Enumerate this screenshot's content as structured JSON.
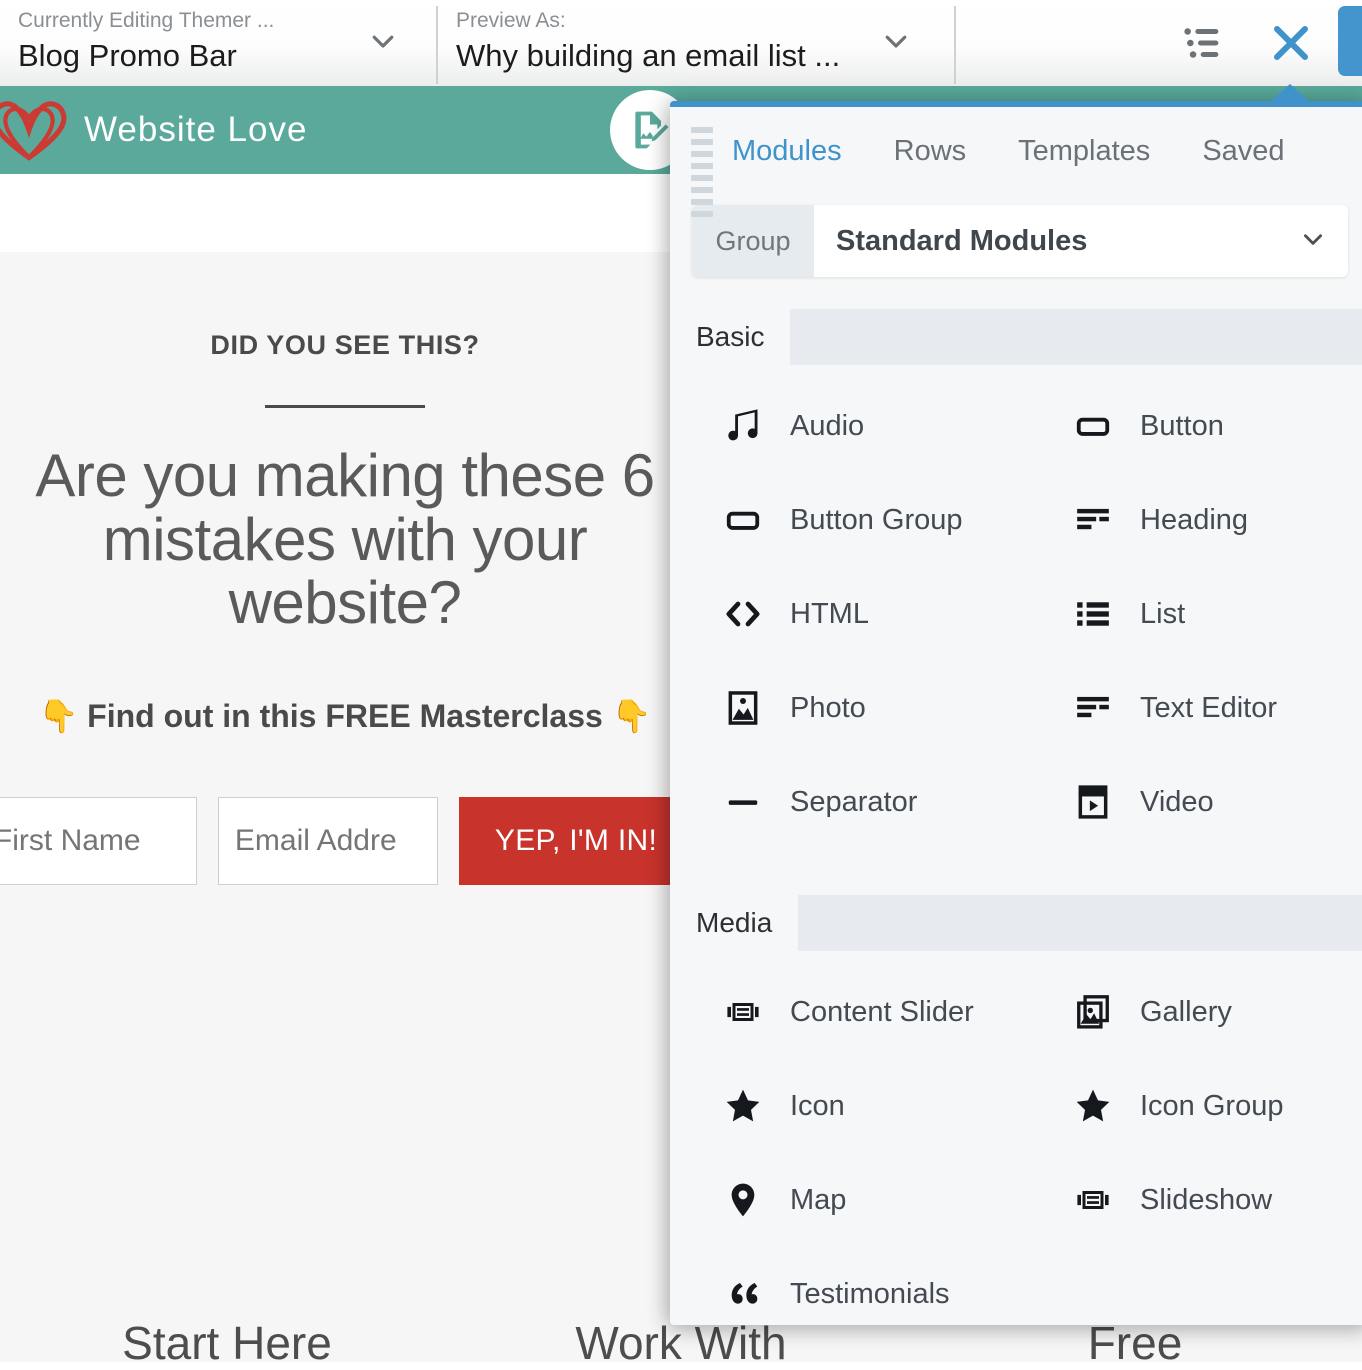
{
  "topbar": {
    "editing": {
      "label": "Currently Editing Themer ...",
      "value": "Blog Promo Bar",
      "caret_icon": "chevron-down-icon"
    },
    "preview": {
      "label": "Preview As:",
      "value": "Why building an email list ...",
      "caret_icon": "chevron-down-icon"
    },
    "outline_icon": "outline-list-icon",
    "close_icon": "close-x-icon",
    "accent_blue": "#4495cd"
  },
  "site": {
    "brand": "Website Love",
    "logo_icon": "heart-logo-icon",
    "badge_icon": "document-edit-icon",
    "header_bg": "#5aa99b"
  },
  "promo": {
    "kicker": "DID YOU SEE THIS?",
    "headline": "Are you making these 6 mistakes with your website?",
    "subheading": "👇 Find out in this FREE Masterclass 👇",
    "first_name_placeholder": "First Name",
    "email_placeholder": "Email Addre",
    "cta_label": "YEP, I'M IN!",
    "cta_color": "#c8332c"
  },
  "lower_sections": [
    {
      "label": "Start Here"
    },
    {
      "label": "Work With"
    },
    {
      "label": "Free"
    }
  ],
  "panel": {
    "grip_icon": "drag-grip-icon",
    "accent": "#3f93ca",
    "tabs": [
      {
        "label": "Modules",
        "active": true
      },
      {
        "label": "Rows",
        "active": false
      },
      {
        "label": "Templates",
        "active": false
      },
      {
        "label": "Saved",
        "active": false
      }
    ],
    "group": {
      "chip_label": "Group",
      "selected": "Standard Modules",
      "caret_icon": "chevron-down-icon"
    },
    "sections": [
      {
        "title": "Basic",
        "modules": [
          {
            "label": "Audio",
            "icon": "music-note-icon"
          },
          {
            "label": "Button",
            "icon": "button-rect-icon"
          },
          {
            "label": "Button Group",
            "icon": "button-rect-icon"
          },
          {
            "label": "Heading",
            "icon": "heading-lines-icon"
          },
          {
            "label": "HTML",
            "icon": "code-brackets-icon"
          },
          {
            "label": "List",
            "icon": "bullet-list-icon"
          },
          {
            "label": "Photo",
            "icon": "photo-frame-icon"
          },
          {
            "label": "Text Editor",
            "icon": "text-lines-icon"
          },
          {
            "label": "Separator",
            "icon": "separator-dash-icon"
          },
          {
            "label": "Video",
            "icon": "video-film-icon"
          }
        ]
      },
      {
        "title": "Media",
        "modules": [
          {
            "label": "Content Slider",
            "icon": "content-slider-icon"
          },
          {
            "label": "Gallery",
            "icon": "gallery-stack-icon"
          },
          {
            "label": "Icon",
            "icon": "star-icon"
          },
          {
            "label": "Icon Group",
            "icon": "star-icon"
          },
          {
            "label": "Map",
            "icon": "map-pin-icon"
          },
          {
            "label": "Slideshow",
            "icon": "slideshow-icon"
          },
          {
            "label": "Testimonials",
            "icon": "quote-marks-icon"
          }
        ]
      }
    ]
  }
}
